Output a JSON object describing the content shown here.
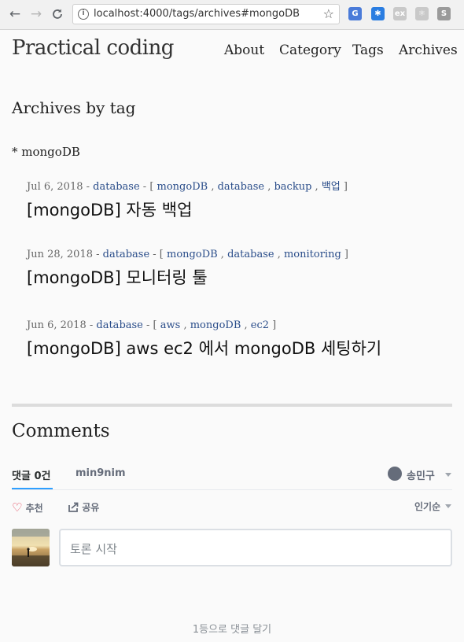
{
  "browser": {
    "url": "localhost:4000/tags/archives#mongoDB",
    "back": "←",
    "forward": "→",
    "reload": "C",
    "star": "☆",
    "info": "i",
    "extensions": [
      {
        "name": "translate-extension-icon",
        "label": "G",
        "color": "#4a7bd9"
      },
      {
        "name": "blue-extension-icon",
        "label": "✱",
        "color": "#2a7de1"
      },
      {
        "name": "gray-extension-icon",
        "label": "ex",
        "color": "#c9c9c9"
      },
      {
        "name": "react-devtools-icon",
        "label": "⚛",
        "color": "#c9c9c9"
      },
      {
        "name": "s-extension-icon",
        "label": "S",
        "color": "#9a9a9a"
      }
    ]
  },
  "site": {
    "title": "Practical coding",
    "nav": [
      "About",
      "Category",
      "Tags",
      "Archives"
    ]
  },
  "page": {
    "heading": "Archives by tag",
    "tag_heading": "* mongoDB"
  },
  "posts": [
    {
      "date": "Jul 6, 2018",
      "category": "database",
      "tags": [
        "mongoDB",
        "database",
        "backup",
        "백업"
      ],
      "title": "[mongoDB] 자동 백업"
    },
    {
      "date": "Jun 28, 2018",
      "category": "database",
      "tags": [
        "mongoDB",
        "database",
        "monitoring"
      ],
      "title": "[mongoDB] 모니터링 툴"
    },
    {
      "date": "Jun 6, 2018",
      "category": "database",
      "tags": [
        "aws",
        "mongoDB",
        "ec2"
      ],
      "title": "[mongoDB] aws ec2 에서 mongoDB 세팅하기"
    }
  ],
  "comments": {
    "heading": "Comments",
    "count_tab": "댓글 0건",
    "forum_tab": "min9nim",
    "user": "송민구",
    "recommend": "추천",
    "share": "공유",
    "sort": "인기순",
    "placeholder": "토론 시작",
    "first_comment": "1등으로 댓글 달기"
  }
}
